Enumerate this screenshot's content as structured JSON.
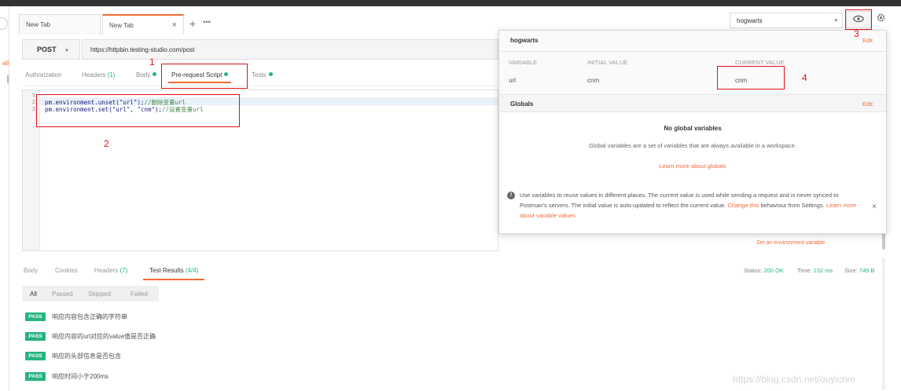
{
  "tabs": [
    {
      "label": "New Tab"
    },
    {
      "label": "New Tab",
      "close": "×"
    }
  ],
  "tab_add": "+",
  "tab_more": "•••",
  "left_sidebar": {
    "label": "all"
  },
  "environment": {
    "selected": "hogwarts",
    "caret": "▾",
    "quick_look_icon": "eye-icon",
    "settings_icon": "gear-icon"
  },
  "request": {
    "method": "POST",
    "method_caret": "▼",
    "url": "https://httpbin.testing-studio.com/post"
  },
  "request_tabs": [
    {
      "label": "Authorization"
    },
    {
      "label": "Headers",
      "count": "(1)"
    },
    {
      "label": "Body"
    },
    {
      "label": "Pre-request Script"
    },
    {
      "label": "Tests"
    }
  ],
  "editor": {
    "line_numbers": [
      "1",
      "2",
      "3"
    ],
    "lines": [
      {
        "code": "pm.environment.unset(\"url\");",
        "comment": "//删除变量url"
      },
      {
        "code": "pm.environment.set(\"url\", \"cnm\");",
        "comment": "//设置变量url"
      }
    ]
  },
  "popover": {
    "env_name": "hogwarts",
    "edit_label": "Edit",
    "columns": [
      "VARIABLE",
      "INITIAL VALUE",
      "CURRENT VALUE"
    ],
    "rows": [
      {
        "variable": "url",
        "initial": "cnm",
        "current": "cnm"
      }
    ],
    "globals_title": "Globals",
    "globals_edit": "Edit",
    "no_globals_title": "No global variables",
    "no_globals_desc": "Global variables are a set of variables that are always available in a workspace.",
    "learn_globals": "Learn more about globals",
    "info_icon": "!",
    "info_text": "Use variables to reuse values in different places. The current value is used while sending a request and is never synced to Postman's servers. The initial value is auto-updated to reflect the current value. ",
    "info_change_link": "Change this",
    "info_text_2": " behaviour from Settings. ",
    "info_learn_link": "Learn more about variable values",
    "info_close": "×"
  },
  "set_env_link": "Set an environment variable",
  "annotations": [
    "1",
    "2",
    "3",
    "4"
  ],
  "response_tabs": [
    {
      "label": "Body"
    },
    {
      "label": "Cookies"
    },
    {
      "label": "Headers",
      "count": "(7)"
    },
    {
      "label": "Test Results",
      "count": "(4/4)"
    }
  ],
  "response_status": {
    "status_label": "Status:",
    "status_value": "200 OK",
    "time_label": "Time:",
    "time_value": "132 ms",
    "size_label": "Size:",
    "size_value": "749 B"
  },
  "test_filters": [
    "All",
    "Passed",
    "Skipped",
    "Failed"
  ],
  "tests": [
    {
      "badge": "PASS",
      "name": "响应内容包含正确的字符串"
    },
    {
      "badge": "PASS",
      "name": "响应内容的url对应的value值是否正确"
    },
    {
      "badge": "PASS",
      "name": "响应的头部信息是否包含"
    },
    {
      "badge": "PASS",
      "name": "响应时间小于200ms"
    }
  ],
  "watermark": "https://blog.csdn.net/ouyicnm",
  "colors": {
    "accent": "#f26b3a",
    "success": "#26b47f",
    "annotation": "#e0101a"
  }
}
